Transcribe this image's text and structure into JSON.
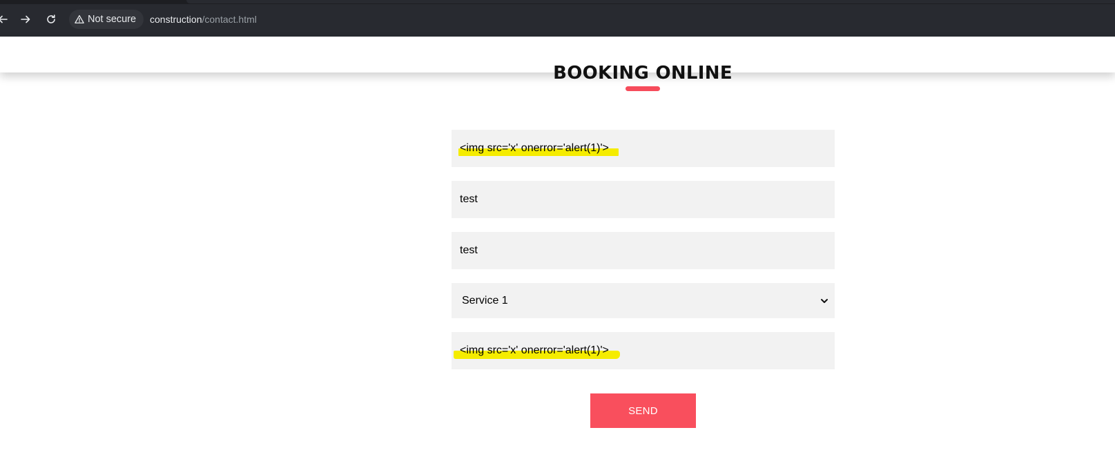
{
  "browser": {
    "security_label": "Not secure",
    "url_host": "construction",
    "url_path": "/contact.html"
  },
  "page": {
    "title": "BOOKING ONLINE",
    "accent_color": "#f64c5b"
  },
  "form": {
    "field_1_value": "<img src='x' onerror='alert(1)'>",
    "field_2_value": "test",
    "field_3_value": "test",
    "service_selected": "Service 1",
    "field_5_value": "<img src='x' onerror='alert(1)'>",
    "send_label": "SEND"
  }
}
